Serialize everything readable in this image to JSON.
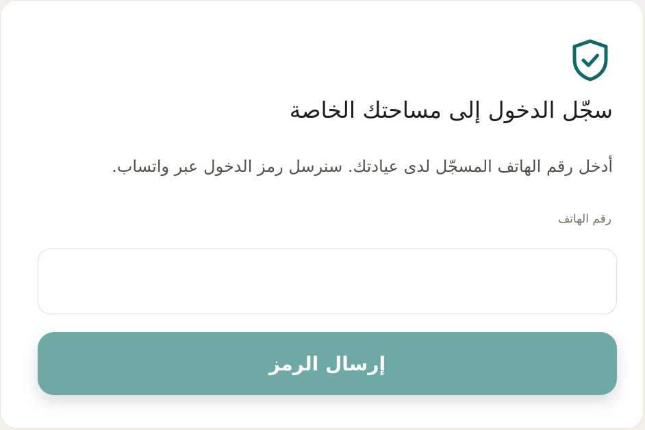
{
  "colors": {
    "accent": "#0f6b65",
    "button_bg": "#6fa9a5",
    "button_text": "#ffffff",
    "label_text": "#7a6e5c",
    "input_border": "#e4dccd"
  },
  "header": {
    "icon": "shield-check-icon",
    "title": "سجّل الدخول إلى مساحتك الخاصة"
  },
  "form": {
    "description": "أدخل رقم الهاتف المسجّل لدى عيادتك. سنرسل رمز الدخول عبر واتساب.",
    "phone_label": "رقم الهاتف",
    "phone_value": "",
    "phone_placeholder": "",
    "submit_label": "إرسال الرمز"
  }
}
